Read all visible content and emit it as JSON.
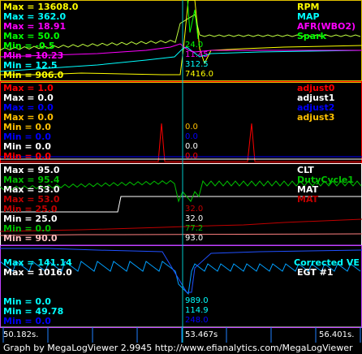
{
  "colors": {
    "yellow": "#ffff00",
    "cyan": "#00ffff",
    "magenta": "#ff00ff",
    "green": "#00ff00",
    "red": "#ff0000",
    "white": "#ffffff",
    "blue": "#0000ff",
    "orange": "#ffc000",
    "darkred": "#c00000",
    "separator_yellow": "#e0c000",
    "separator_red": "#ff0000",
    "separator_white": "#ffffff",
    "separator_violet": "#c040ff",
    "cursor": "#00c8c8"
  },
  "panel1": {
    "left": [
      {
        "text": "Max = 13608.0",
        "color": "#ffff00"
      },
      {
        "text": "Max = 362.0",
        "color": "#00ffff"
      },
      {
        "text": "Max = 18.91",
        "color": "#ff00ff"
      },
      {
        "text": "Max = 50.0",
        "color": "#00ff00"
      },
      {
        "text": "Min = -0.5",
        "color": "#00ff00"
      },
      {
        "text": "Min = 10.23",
        "color": "#ff00ff"
      },
      {
        "text": "Min = 12.5",
        "color": "#00ffff"
      },
      {
        "text": "Min = 906.0",
        "color": "#ffff00"
      }
    ],
    "right": [
      {
        "text": "RPM",
        "color": "#ffff00"
      },
      {
        "text": "MAP",
        "color": "#00ffff"
      },
      {
        "text": "AFR(WBO2)",
        "color": "#ff00ff"
      },
      {
        "text": "Spark",
        "color": "#00ff00"
      }
    ],
    "cursor_values": [
      {
        "text": "24.0",
        "color": "#00ff00"
      },
      {
        "text": "11.45",
        "color": "#ff00ff"
      },
      {
        "text": "312.5",
        "color": "#00ffff"
      },
      {
        "text": "7416.0",
        "color": "#ffff00"
      }
    ]
  },
  "panel2": {
    "left": [
      {
        "text": "Max = 1.0",
        "color": "#ff0000"
      },
      {
        "text": "Max = 0.0",
        "color": "#ffffff"
      },
      {
        "text": "Max = 0.0",
        "color": "#0000ff"
      },
      {
        "text": "Max = 0.0",
        "color": "#ffc000"
      },
      {
        "text": "Min = 0.0",
        "color": "#ffc000"
      },
      {
        "text": "Min = 0.0",
        "color": "#0000ff"
      },
      {
        "text": "Min = 0.0",
        "color": "#ffffff"
      },
      {
        "text": "Min = 0.0",
        "color": "#ff0000"
      }
    ],
    "right": [
      {
        "text": "adjust0",
        "color": "#ff0000"
      },
      {
        "text": "adjust1",
        "color": "#ffffff"
      },
      {
        "text": "adjust2",
        "color": "#0000ff"
      },
      {
        "text": "adjust3",
        "color": "#ffc000"
      }
    ],
    "cursor_values": [
      {
        "text": "0.0",
        "color": "#ffc000"
      },
      {
        "text": "0.0",
        "color": "#0000ff"
      },
      {
        "text": "0.0",
        "color": "#ffffff"
      },
      {
        "text": "0.0",
        "color": "#ff0000"
      }
    ]
  },
  "panel3": {
    "left": [
      {
        "text": "Max = 95.0",
        "color": "#ffffff"
      },
      {
        "text": "Max = 95.4",
        "color": "#00c000"
      },
      {
        "text": "Max = 53.0",
        "color": "#ffffff"
      },
      {
        "text": "Max = 53.0",
        "color": "#c00000"
      },
      {
        "text": "Min = 25.0",
        "color": "#c00000"
      },
      {
        "text": "Min = 25.0",
        "color": "#ffffff"
      },
      {
        "text": "Min = 0.0",
        "color": "#00c000"
      },
      {
        "text": "Min = 90.0",
        "color": "#ffc0c0"
      }
    ],
    "right": [
      {
        "text": "CLT",
        "color": "#ffffff"
      },
      {
        "text": "DutyCycle1",
        "color": "#00c000"
      },
      {
        "text": "MAT",
        "color": "#ffffff"
      },
      {
        "text": "MAT",
        "color": "#c00000"
      }
    ],
    "cursor_values": [
      {
        "text": "32.0",
        "color": "#c00000"
      },
      {
        "text": "32.0",
        "color": "#ffffff"
      },
      {
        "text": "77.2",
        "color": "#00c000"
      },
      {
        "text": "93.0",
        "color": "#ffffff"
      }
    ]
  },
  "panel4": {
    "left": [
      {
        "text": "Max = 141.14",
        "color": "#00ffff"
      },
      {
        "text": "Max = 1016.0",
        "color": "#ffffff"
      },
      {
        "text": "Min = 0.0",
        "color": "#00ffff"
      },
      {
        "text": "Min = 49.78",
        "color": "#00ffff"
      },
      {
        "text": "Min = 0.0",
        "color": "#0000ff"
      }
    ],
    "right": [
      {
        "text": "Corrected VE",
        "color": "#00ffff"
      },
      {
        "text": "EGT #1",
        "color": "#ffffff"
      }
    ],
    "cursor_values": [
      {
        "text": "989.0",
        "color": "#00ffff"
      },
      {
        "text": "114.9",
        "color": "#00ffff"
      },
      {
        "text": "248.0",
        "color": "#0000ff"
      }
    ]
  },
  "timeline": {
    "start": "50.182s.",
    "cursor": "53.467s",
    "end": "56.401s."
  },
  "footer": {
    "text": "Graph by MegaLogViewer 2.9945 http://www.efianalytics.com/MegaLogViewer"
  }
}
